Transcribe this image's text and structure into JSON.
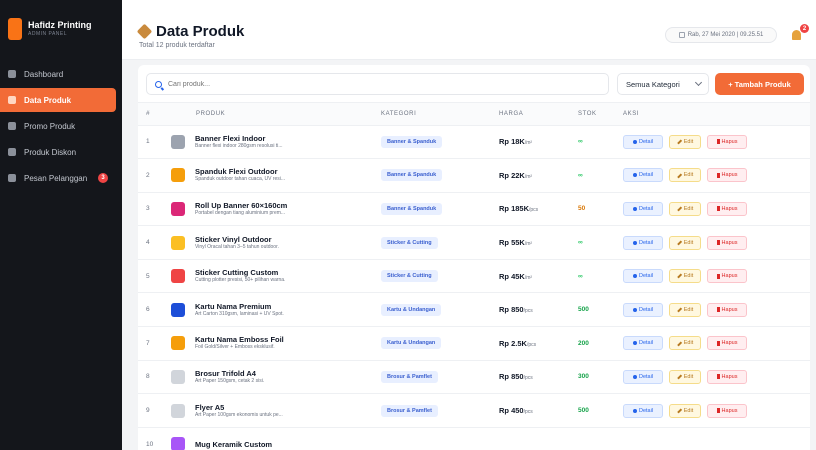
{
  "brand": {
    "name": "Hafidz Printing",
    "subtitle": "ADMIN PANEL"
  },
  "sidebar": {
    "items": [
      {
        "label": "Dashboard"
      },
      {
        "label": "Data Produk",
        "active": true
      },
      {
        "label": "Promo Produk"
      },
      {
        "label": "Produk Diskon"
      },
      {
        "label": "Pesan Pelanggan",
        "badge": "3"
      }
    ]
  },
  "header": {
    "title": "Data Produk",
    "subtitle": "Total 12 produk terdaftar",
    "datetime": "Rab, 27 Mei 2020 | 09.25.51",
    "notif_count": "2"
  },
  "toolbar": {
    "search_placeholder": "Cari produk...",
    "category_select": "Semua Kategori",
    "add_label": "+ Tambah Produk"
  },
  "table": {
    "headers": [
      "#",
      "PRODUK",
      "KATEGORI",
      "HARGA",
      "STOK",
      "AKSI"
    ],
    "actions": {
      "detail": "Detail",
      "edit": "Edit",
      "hapus": "Hapus"
    },
    "rows": [
      {
        "no": "1",
        "name": "Banner Flexi Indoor",
        "desc": "Banner flexi indoor 280gsm resolusi ti...",
        "category": "Banner & Spanduk",
        "price": "Rp 18K",
        "unit": "/m²",
        "stock": "∞",
        "thumb": "#9ca3af"
      },
      {
        "no": "2",
        "name": "Spanduk Flexi Outdoor",
        "desc": "Spanduk outdoor tahan cuaca, UV resi...",
        "category": "Banner & Spanduk",
        "price": "Rp 22K",
        "unit": "/m²",
        "stock": "∞",
        "thumb": "#f59e0b"
      },
      {
        "no": "3",
        "name": "Roll Up Banner 60×160cm",
        "desc": "Portabel dengan tiang aluminium prem...",
        "category": "Banner & Spanduk",
        "price": "Rp 185K",
        "unit": "/pcs",
        "stock": "50",
        "thumb": "#db2777"
      },
      {
        "no": "4",
        "name": "Sticker Vinyl Outdoor",
        "desc": "Vinyl Oracal tahan 3–5 tahun outdoor.",
        "category": "Sticker & Cutting",
        "price": "Rp 55K",
        "unit": "/m²",
        "stock": "∞",
        "thumb": "#fbbf24"
      },
      {
        "no": "5",
        "name": "Sticker Cutting Custom",
        "desc": "Cutting plotter presisi, 50+ pilihan warna.",
        "category": "Sticker & Cutting",
        "price": "Rp 45K",
        "unit": "/m²",
        "stock": "∞",
        "thumb": "#ef4444"
      },
      {
        "no": "6",
        "name": "Kartu Nama Premium",
        "desc": "Art Carton 310gsm, laminasi + UV Spot.",
        "category": "Kartu & Undangan",
        "price": "Rp 850",
        "unit": "/pcs",
        "stock": "500",
        "thumb": "#1d4ed8"
      },
      {
        "no": "7",
        "name": "Kartu Nama Emboss Foil",
        "desc": "Foil Gold/Silver + Emboss eksklusif.",
        "category": "Kartu & Undangan",
        "price": "Rp 2.5K",
        "unit": "/pcs",
        "stock": "200",
        "thumb": "#f59e0b"
      },
      {
        "no": "8",
        "name": "Brosur Trifold A4",
        "desc": "Art Paper 150gsm, cetak 2 sisi.",
        "category": "Brosur & Pamflet",
        "price": "Rp 850",
        "unit": "/pcs",
        "stock": "300",
        "thumb": "#d1d5db"
      },
      {
        "no": "9",
        "name": "Flyer A5",
        "desc": "Art Paper 100gsm ekonomis untuk pe...",
        "category": "Brosur & Pamflet",
        "price": "Rp 450",
        "unit": "/pcs",
        "stock": "500",
        "thumb": "#d1d5db"
      },
      {
        "no": "10",
        "name": "Mug Keramik Custom",
        "desc": "",
        "category": "",
        "price": "",
        "unit": "",
        "stock": "",
        "thumb": "#a855f7"
      }
    ]
  },
  "colors": {
    "accent": "#f26b37",
    "sidebar_bg": "#14161b",
    "stock_unlimited": "#22c55e",
    "stock_limited": "#16a34a",
    "stock_low": "#d97706"
  }
}
